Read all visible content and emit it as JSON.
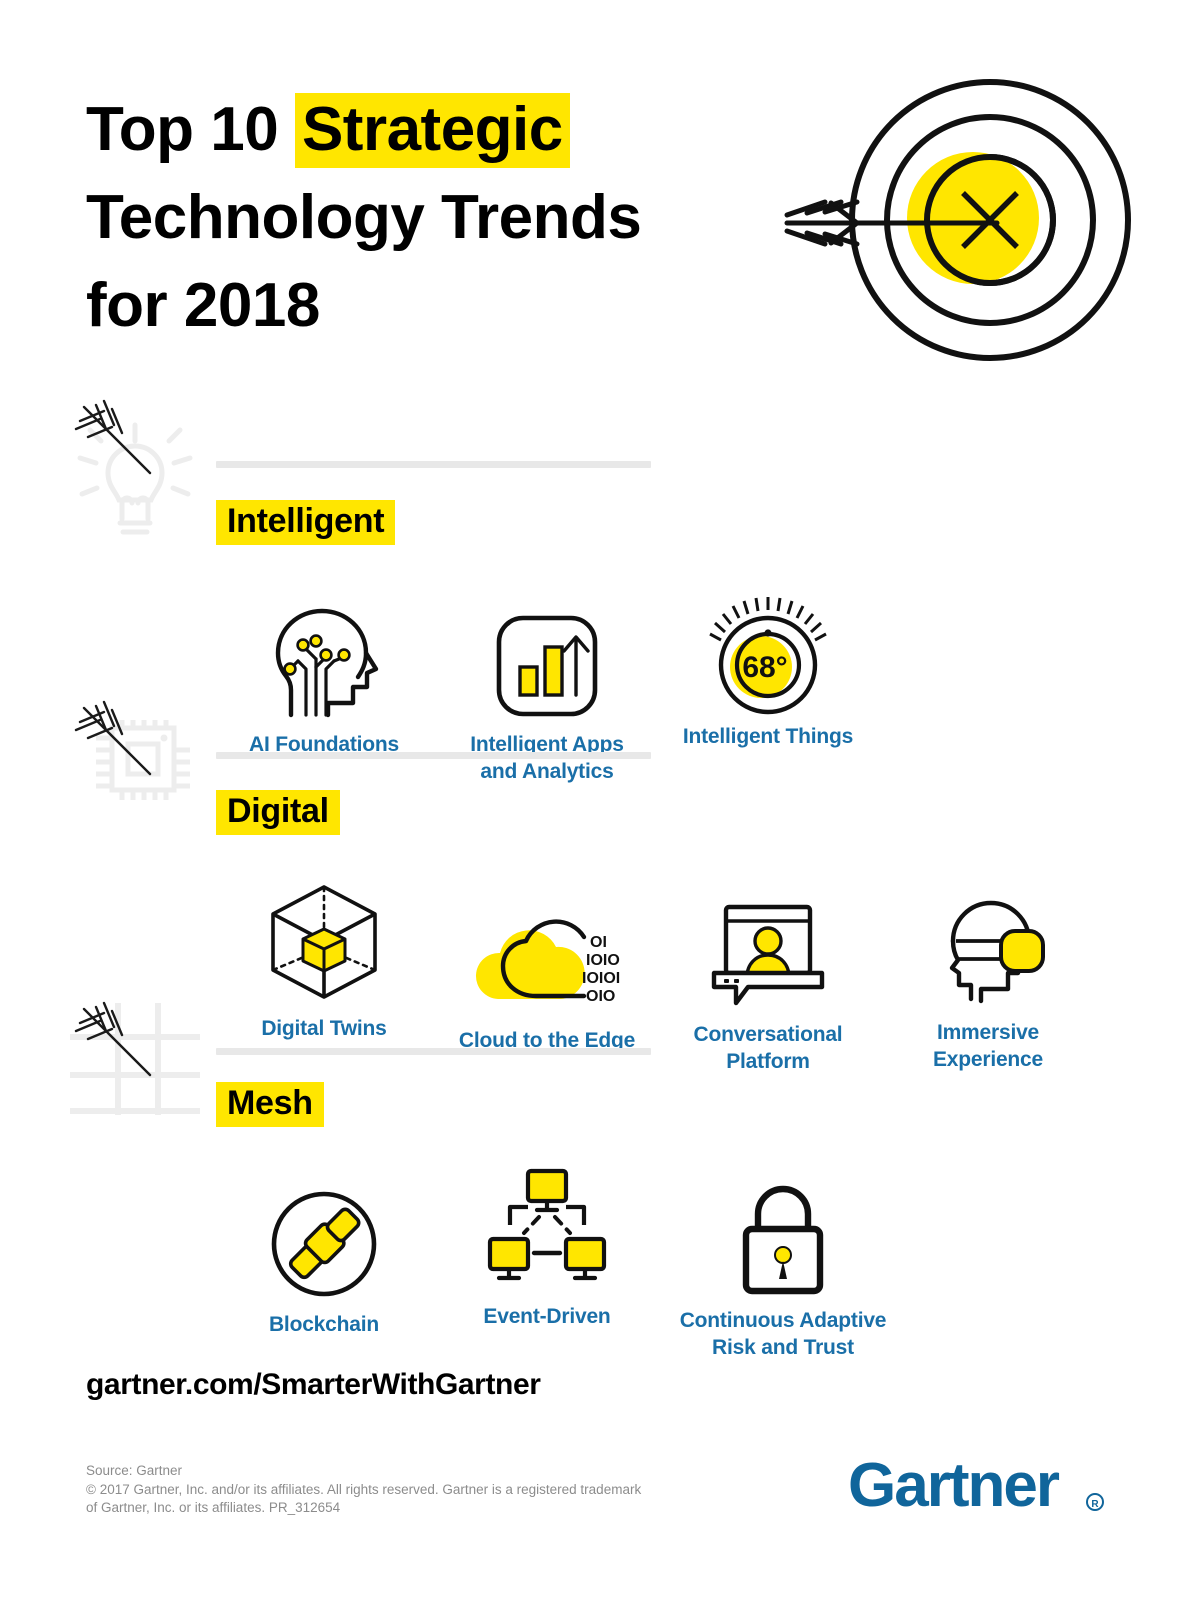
{
  "header": {
    "title_line1_plain": "Top 10 ",
    "title_line1_highlight": "Strategic",
    "title_line2": "Technology Trends",
    "title_line3": "for 2018",
    "target_icon": "target-with-arrow-icon"
  },
  "colors": {
    "accent_yellow": "#FFE600",
    "label_blue": "#1A6FA8",
    "logo_blue": "#10659B",
    "divider_gray": "#E8E8E8",
    "legal_gray": "#8C8C8C",
    "outline_black": "#111111"
  },
  "watermarks": [
    {
      "name": "lightbulb-watermark",
      "icon": "lightbulb-icon"
    },
    {
      "name": "microchip-watermark",
      "icon": "microchip-icon"
    },
    {
      "name": "grid-mesh-watermark",
      "icon": "grid-icon"
    }
  ],
  "sections": [
    {
      "category": "Intelligent",
      "items": [
        {
          "label": "AI Foundations",
          "icon": "brain-head-circuit-icon"
        },
        {
          "label": "Intelligent Apps and Analytics",
          "label_line1": "Intelligent Apps",
          "label_line2": "and Analytics",
          "icon": "bar-chart-growth-icon"
        },
        {
          "label": "Intelligent Things",
          "icon": "thermostat-dial-icon",
          "icon_value": "68°"
        }
      ]
    },
    {
      "category": "Digital",
      "items": [
        {
          "label": "Digital Twins",
          "icon": "wireframe-cube-icon"
        },
        {
          "label": "Cloud to the Edge",
          "icon": "cloud-binary-icon",
          "binary": [
            "OI",
            "IOIO",
            "IOIOI",
            "OIO"
          ]
        },
        {
          "label": "Conversational Platform",
          "label_line1": "Conversational",
          "label_line2": "Platform",
          "icon": "laptop-chat-person-icon"
        },
        {
          "label": "Immersive Experience",
          "label_line1": "Immersive",
          "label_line2": "Experience",
          "icon": "vr-headset-head-icon"
        }
      ]
    },
    {
      "category": "Mesh",
      "items": [
        {
          "label": "Blockchain",
          "icon": "blockchain-circle-icon"
        },
        {
          "label": "Event-Driven",
          "icon": "connected-monitors-icon"
        },
        {
          "label": "Continuous Adaptive Risk and Trust",
          "label_line1": "Continuous Adaptive",
          "label_line2": "Risk and Trust",
          "icon": "padlock-icon"
        }
      ]
    }
  ],
  "footer": {
    "url": "gartner.com/SmarterWithGartner",
    "source": "Source: Gartner",
    "copyright_line1": "© 2017 Gartner, Inc. and/or its affiliates. All rights reserved. Gartner is a registered trademark",
    "copyright_line2": "of Gartner, Inc. or its affiliates. PR_312654",
    "logo_text": "Gartner",
    "logo_mark": "registered-trademark-icon"
  }
}
